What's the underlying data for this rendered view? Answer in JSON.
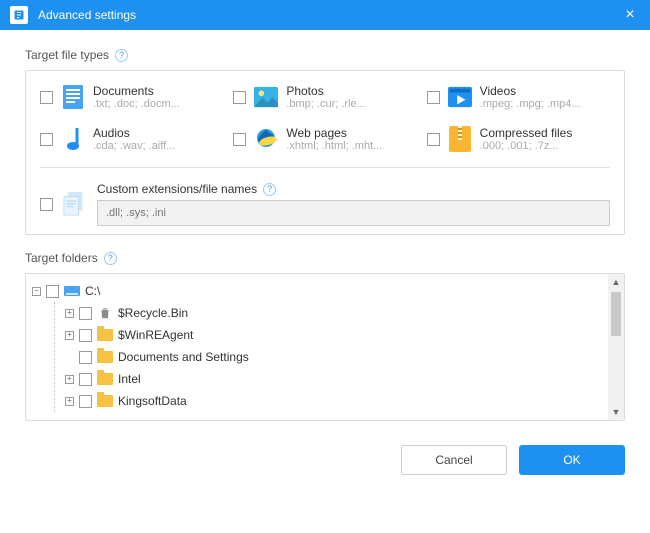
{
  "title": "Advanced settings",
  "sections": {
    "types_label": "Target file types",
    "folders_label": "Target folders"
  },
  "types": {
    "documents": {
      "name": "Documents",
      "ext": ".txt; .doc; .docm..."
    },
    "photos": {
      "name": "Photos",
      "ext": ".bmp; .cur; .rle..."
    },
    "videos": {
      "name": "Videos",
      "ext": ".mpeg; .mpg; .mp4..."
    },
    "audios": {
      "name": "Audios",
      "ext": ".cda; .wav; .aiff..."
    },
    "web": {
      "name": "Web pages",
      "ext": ".xhtml; .html; .mht..."
    },
    "compressed": {
      "name": "Compressed files",
      "ext": ".000; .001; .7z..."
    }
  },
  "custom": {
    "label": "Custom extensions/file names",
    "placeholder": ".dll; .sys; .ini"
  },
  "tree": {
    "root": "C:\\",
    "n0": "$Recycle.Bin",
    "n1": "$WinREAgent",
    "n2": "Documents and Settings",
    "n3": "Intel",
    "n4": "KingsoftData"
  },
  "buttons": {
    "cancel": "Cancel",
    "ok": "OK"
  }
}
